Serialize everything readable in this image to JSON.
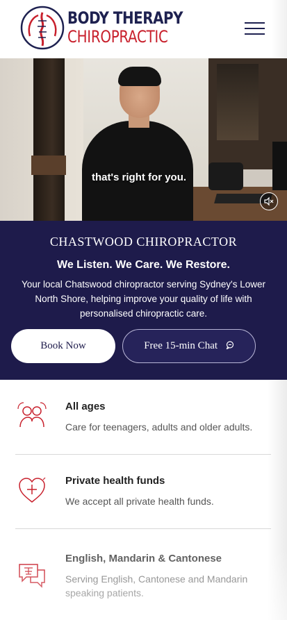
{
  "header": {
    "logo_line1": "BODY THERAPY",
    "logo_line2": "CHIROPRACTIC",
    "menu_icon": "hamburger-menu-icon"
  },
  "hero": {
    "caption": "that's right for you.",
    "mute_icon": "volume-muted-icon"
  },
  "intro": {
    "eyebrow": "CHASTWOOD CHIROPRACTOR",
    "headline": "We Listen. We Care. We Restore.",
    "body": "Your local Chatswood chiropractor serving Sydney's Lower North Shore, helping improve your quality of life with personalised chiropractic care.",
    "book_label": "Book Now",
    "chat_label": "Free 15-min Chat",
    "chat_icon": "chat-bubble-icon"
  },
  "features": [
    {
      "title": "All ages",
      "desc": "Care for teenagers, adults and older adults.",
      "icon": "people-icon"
    },
    {
      "title": "Private health funds",
      "desc": "We accept all private health funds.",
      "icon": "heart-plus-icon"
    },
    {
      "title": "English, Mandarin & Cantonese",
      "desc": "Serving English, Cantonese and Mandarin speaking patients.",
      "icon": "language-chat-icon"
    }
  ],
  "colors": {
    "navy": "#1e1b4b",
    "brand_red": "#c8202c",
    "logo_navy": "#1e2150"
  }
}
